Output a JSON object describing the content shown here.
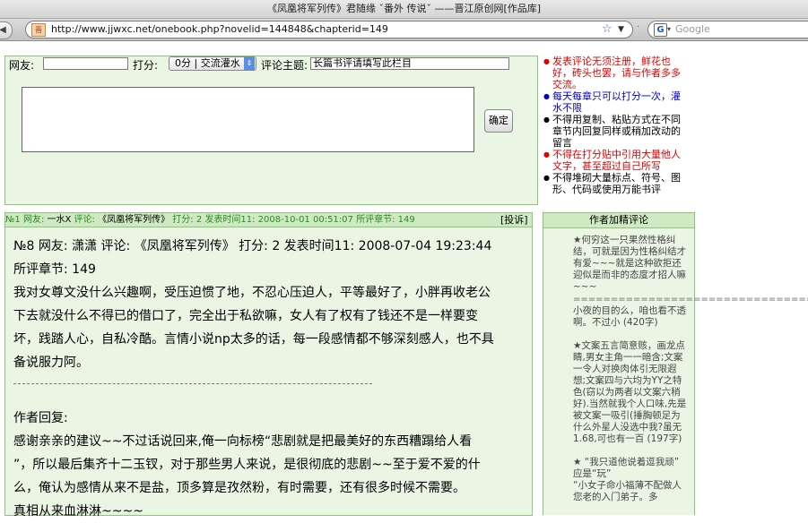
{
  "window": {
    "title": "《凤凰将军列传》君随缘 ˇ番外 传说ˇ ——晋江原创网[作品库]"
  },
  "toolbar": {
    "back_icon": "back-arrow-icon",
    "url": "http://www.jjwxc.net/onebook.php?novelid=144848&chapterid=149",
    "search_placeholder": "Google",
    "search_engine_letter": "G",
    "site_icon_letter": "晋"
  },
  "form": {
    "user_label": "网友:",
    "score_label": "打分:",
    "score_value": "0分 | 交流灌水",
    "topic_label": "评论主题:",
    "topic_value": "长篇书评请填写此栏目",
    "confirm_label": "确定"
  },
  "rules": [
    {
      "text": "发表评论无须注册，鲜花也好，砖头也罢，请与作者多多交流。",
      "color": "red"
    },
    {
      "text": "每天每章只可以打分一次，灌水不限",
      "color": "blue"
    },
    {
      "text": "不得用复制、粘贴方式在不同章节内回复同样或稍加改动的留言",
      "color": "black"
    },
    {
      "text": "不得在打分贴中引用大量他人文字，甚至超过自己所写",
      "color": "red"
    },
    {
      "text": "不得堆砌大量标点、符号、图形、代码或使用万能书评",
      "color": "black"
    }
  ],
  "comment_header": {
    "no": "№1 网友:",
    "user": "一水X",
    "comment_label": "评论:",
    "book": "《凤凰将军列传》",
    "score": "打分: 2",
    "time": "发表时间11: 2008-10-01 00:51:07",
    "chapter": "所评章节: 149",
    "report": "[投诉]"
  },
  "comment": {
    "lines": [
      "№8 网友: 潇潇 评论: 《凤凰将军列传》 打分: 2 发表时间11: 2008-07-04 19:23:44",
      "所评章节: 149",
      "我对女尊文没什么兴趣啊，受压迫惯了地，不忍心压迫人，平等最好了，小胖再收老公",
      "下去就没什么不得已的借口了，完全出于私欲嘛，女人有了权有了钱还不是一样要变",
      "坏，践踏人心，自私冷酷。言情小说np太多的话，每一段感情都不够深刻感人，也不具",
      "备说服力阿。"
    ]
  },
  "reply": {
    "lines": [
      "作者回复:",
      "感谢亲亲的建议~~不过话说回来,俺一向标榜“悲剧就是把最美好的东西糟蹋给人看",
      "”，所以最后集齐十二玉钗，对于那些男人来说，是很彻底的悲剧~~至于爱不爱的什",
      "么，俺认为感情从来不是盐，顶多算是孜然粉，有时需要，还有很多时候不需要。",
      "真相从来血淋淋~~~~"
    ]
  },
  "picks": {
    "title": "作者加精评论",
    "items": [
      "★何穷这一只果然性格纠结，可就是因为性格纠结才有爱~~~就是这种欲拒还迎似是而非的态度才招人嘛~~~",
      "小夜的目的么，咱也看不透啊。不过小 (420字)",
      "★文案五言简意赅，画龙点睛,男女主角一一暗含;文案一令人对换肉体引无限遐想;文案四与六均为YY之特色(窃以为两者以文案六稍好).当然就我个人口味,先是被文案一吸引(捶胸顿足为什么外星人没选中我?虽无1.68,可也有一百 (197字)",
      "★ “我只道他说着逗我顽” 应是“玩”",
      "“小女子命小福薄不配做人您老的入门弟子。多"
    ],
    "separator": "================================================"
  }
}
